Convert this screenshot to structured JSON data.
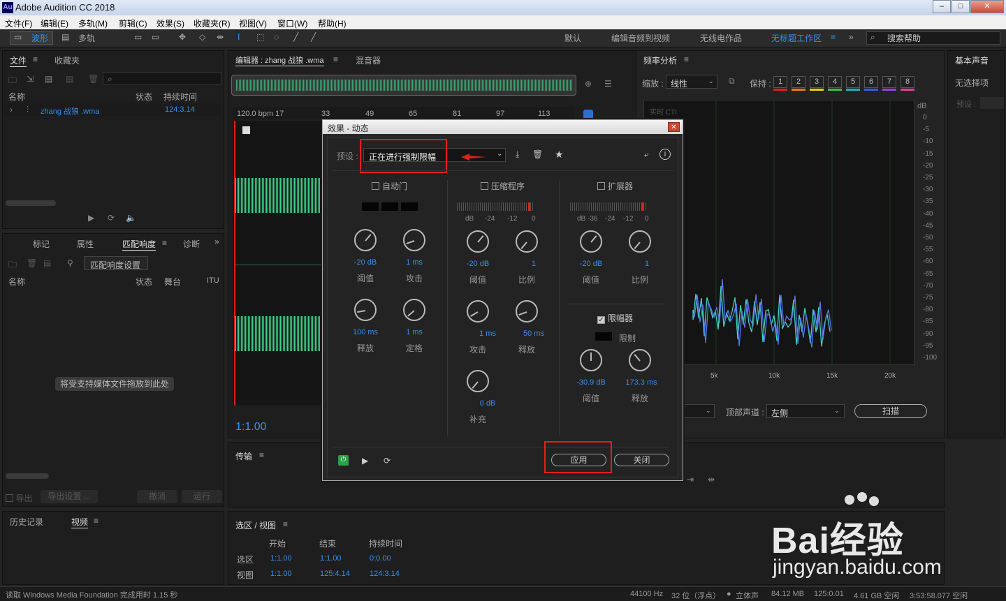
{
  "app": {
    "title": "Adobe Audition CC 2018",
    "logo": "Au"
  },
  "menu": [
    "文件(F)",
    "编辑(E)",
    "多轨(M)",
    "剪辑(C)",
    "效果(S)",
    "收藏夹(R)",
    "视图(V)",
    "窗口(W)",
    "帮助(H)"
  ],
  "toolbar": {
    "waveform": "波形",
    "multitrack": "多轨",
    "workspaces": [
      "默认",
      "编辑音频到视频",
      "无线电作品",
      "无标题工作区"
    ],
    "search_placeholder": "搜索帮助"
  },
  "files_panel": {
    "tab1": "文件",
    "tab2": "收藏夹",
    "col_name": "名称",
    "col_status": "状态",
    "col_duration": "持续时间",
    "file_name": "zhang 战狼 .wma",
    "file_duration": "124:3.14"
  },
  "loudness_panel": {
    "tabs": [
      "标记",
      "属性",
      "匹配响度",
      "诊断"
    ],
    "settings_btn": "匹配响度设置",
    "col_name": "名称",
    "col_status": "状态",
    "col_stage": "舞台",
    "col_itu": "ITU",
    "drop_hint": "将受支持媒体文件拖放到此处",
    "export": "导出",
    "export_settings": "导出设置 ...",
    "cancel": "撤消",
    "run": "运行"
  },
  "history_panel": {
    "tab1": "历史记录",
    "tab2": "视频"
  },
  "editor": {
    "tab_editor": "编辑器 : zhang 战狼 .wma",
    "tab_mixer": "混音器",
    "ruler": [
      "120.0 bpm 17",
      "33",
      "49",
      "65",
      "81",
      "97",
      "113"
    ],
    "time": "1:1.00"
  },
  "transport": {
    "label": "传输"
  },
  "selection": {
    "label": "选区 / 视图",
    "cols": [
      "开始",
      "结束",
      "持续时间"
    ],
    "rows": [
      {
        "name": "选区",
        "start": "1:1.00",
        "end": "1:1.00",
        "dur": "0:0.00"
      },
      {
        "name": "视图",
        "start": "1:1.00",
        "end": "125:4.14",
        "dur": "124:3.14"
      }
    ]
  },
  "freq": {
    "title": "频率分析",
    "zoom_label": "缩放 :",
    "zoom_val": "线性",
    "hold_label": "保持 :",
    "holds": [
      "1",
      "2",
      "3",
      "4",
      "5",
      "6",
      "7",
      "8"
    ],
    "hold_colors": [
      "#e0201a",
      "#f07a10",
      "#e8d010",
      "#40c040",
      "#20b0c0",
      "#3060e0",
      "#a040e0",
      "#e040a0"
    ],
    "cti": "实时 CTI",
    "db_unit": "dB",
    "db_ticks": [
      "0",
      "-5",
      "-10",
      "-15",
      "-20",
      "-25",
      "-30",
      "-35",
      "-40",
      "-45",
      "-50",
      "-55",
      "-60",
      "-65",
      "-70",
      "-75",
      "-80",
      "-85",
      "-90",
      "-95",
      "-100"
    ],
    "x_ticks": [
      "5k",
      "10k",
      "15k",
      "20k"
    ],
    "channel_label": "顶部声道 :",
    "channel_val": "左侧",
    "scan": "扫描"
  },
  "essential": {
    "title": "基本声音",
    "no_sel": "无选择项",
    "preset": "预设 :"
  },
  "dialog": {
    "title": "效果 - 动态",
    "preset_label": "预设 :",
    "preset_val": "正在进行强制限幅",
    "autogate": {
      "label": "自动门",
      "k1v": "-20 dB",
      "k1l": "阈值",
      "k2v": "1 ms",
      "k2l": "攻击",
      "k3v": "100 ms",
      "k3l": "释放",
      "k4v": "1 ms",
      "k4l": "定格"
    },
    "compressor": {
      "label": "压缩程序",
      "scale": [
        "dB",
        "-24",
        "-12",
        "0"
      ],
      "k1v": "-20 dB",
      "k1l": "阈值",
      "k2v": "1",
      "k2l": "比例",
      "k3v": "1 ms",
      "k3l": "攻击",
      "k4v": "50 ms",
      "k4l": "释放",
      "k5v": "0 dB",
      "k5l": "补充"
    },
    "expander": {
      "label": "扩展器",
      "scale": [
        "dB -36",
        "-24",
        "-12",
        "0"
      ],
      "k1v": "-20 dB",
      "k1l": "阈值",
      "k2v": "1",
      "k2l": "比例"
    },
    "limiter": {
      "label": "限幅器",
      "limit": "限制",
      "k1v": "-30.9 dB",
      "k1l": "阈值",
      "k2v": "173.3 ms",
      "k2l": "释放"
    },
    "apply": "应用",
    "close": "关闭"
  },
  "status": {
    "left": "读取 Windows Media Foundation 完成用时 1.15 秒",
    "rate": "44100 Hz",
    "bits": "32 位（浮点）",
    "ch": "立体声",
    "size": "84.12 MB",
    "dur": "125:0.01",
    "free": "4.61 GB 空闲",
    "free_time": "3:53:58.077 空闲"
  },
  "watermark": {
    "brand": "Bai经验",
    "url": "jingyan.baidu.com"
  }
}
